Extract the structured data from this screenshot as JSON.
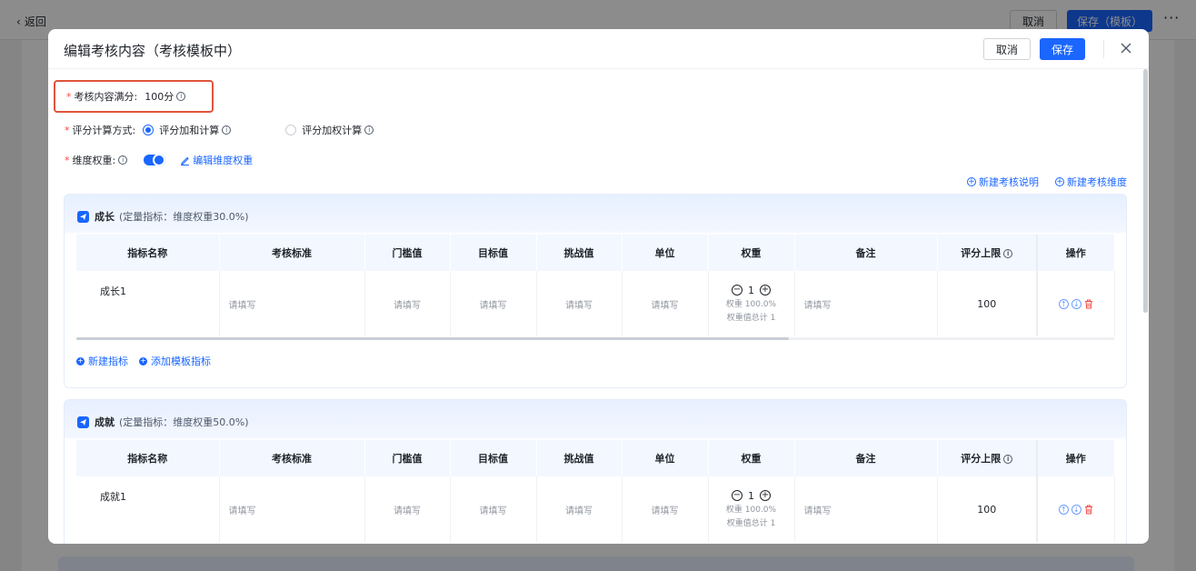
{
  "background": {
    "back_label": "返回",
    "cancel_label": "取消",
    "save_label": "保存（模板）",
    "more_label": "···"
  },
  "modal": {
    "title": "编辑考核内容（考核模板中）",
    "cancel_label": "取消",
    "save_label": "保存",
    "close_icon": "close-icon"
  },
  "form": {
    "full_score": {
      "label": "考核内容满分:",
      "value": "100分"
    },
    "calc_method": {
      "label": "评分计算方式:",
      "options": [
        {
          "label": "评分加和计算",
          "selected": true
        },
        {
          "label": "评分加权计算",
          "selected": false
        }
      ]
    },
    "dimension_weight": {
      "label": "维度权重:",
      "enabled": true,
      "edit_link": "编辑维度权重"
    },
    "new_note_link": "新建考核说明",
    "new_dimension_link": "新建考核维度"
  },
  "columns": [
    "指标名称",
    "考核标准",
    "门槛值",
    "目标值",
    "挑战值",
    "单位",
    "权重",
    "备注",
    "评分上限",
    "操作"
  ],
  "dimensions": [
    {
      "name": "成长",
      "note": "(定量指标：维度权重30.0%)",
      "rows": [
        {
          "indicator": "成长1",
          "standard": "请填写",
          "threshold": "请填写",
          "target": "请填写",
          "challenge": "请填写",
          "unit": "请填写",
          "weight_value": "1",
          "weight_pct": "权重 100.0%",
          "weight_total": "权重值总计 1",
          "remark": "请填写",
          "score_limit": "100"
        }
      ],
      "actions": {
        "new_indicator": "新建指标",
        "add_template": "添加模板指标"
      }
    },
    {
      "name": "成就",
      "note": "(定量指标：维度权重50.0%)",
      "rows": [
        {
          "indicator": "成就1",
          "standard": "请填写",
          "threshold": "请填写",
          "target": "请填写",
          "challenge": "请填写",
          "unit": "请填写",
          "weight_value": "1",
          "weight_pct": "权重 100.0%",
          "weight_total": "权重值总计 1",
          "remark": "请填写",
          "score_limit": "100"
        }
      ]
    }
  ],
  "colors": {
    "accent": "#1a66ff",
    "danger": "#f54a45",
    "highlight_border": "#e0543c"
  }
}
